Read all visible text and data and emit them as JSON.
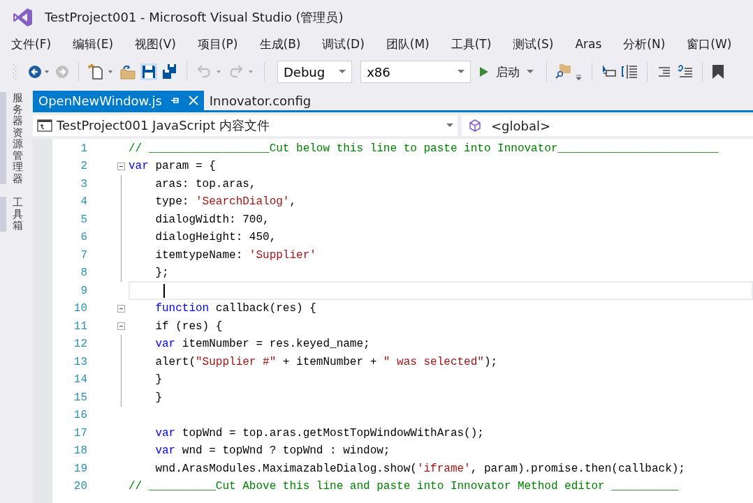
{
  "window": {
    "title": "TestProject001 - Microsoft Visual Studio (管理员)"
  },
  "menu": [
    "文件(F)",
    "编辑(E)",
    "视图(V)",
    "项目(P)",
    "生成(B)",
    "调试(D)",
    "团队(M)",
    "工具(T)",
    "测试(S)",
    "Aras",
    "分析(N)",
    "窗口(W)"
  ],
  "toolbar": [
    {
      "kind": "back",
      "disabled": false
    },
    {
      "kind": "forward",
      "disabled": true
    },
    {
      "kind": "sep"
    },
    {
      "kind": "new-item"
    },
    {
      "kind": "open"
    },
    {
      "kind": "save"
    },
    {
      "kind": "save-all"
    },
    {
      "kind": "sep"
    },
    {
      "kind": "undo",
      "disabled": true
    },
    {
      "kind": "redo",
      "disabled": true
    },
    {
      "kind": "sep"
    },
    {
      "kind": "combo",
      "value": "Debug"
    },
    {
      "kind": "combo",
      "value": "x86"
    },
    {
      "kind": "start",
      "label": "启动"
    },
    {
      "kind": "sep"
    },
    {
      "kind": "find"
    },
    {
      "kind": "sep"
    },
    {
      "kind": "select"
    },
    {
      "kind": "outline"
    },
    {
      "kind": "sep"
    },
    {
      "kind": "indent"
    },
    {
      "kind": "unindent"
    },
    {
      "kind": "sep"
    },
    {
      "kind": "bookmark"
    }
  ],
  "side_tabs": [
    "服务器资源管理器",
    "工具箱"
  ],
  "tabs": [
    {
      "label": "OpenNewWindow.js",
      "selected": true
    },
    {
      "label": "Innovator.config",
      "selected": false
    }
  ],
  "nav_bar": {
    "project": "TestProject001 JavaScript 内容文件",
    "scope": "<global>"
  },
  "lines": [
    {
      "number": "1",
      "indented": false,
      "collapsible": false,
      "in_block": false,
      "current": false,
      "code": [
        {
          "kind": "comment",
          "text": "// __________________Cut below this line to paste into Innovator________________________"
        }
      ]
    },
    {
      "number": "2",
      "indented": false,
      "collapsible": true,
      "current": false,
      "code": [
        {
          "kind": "keyword",
          "text": "var"
        },
        {
          "kind": "plain",
          "text": " param = {"
        }
      ]
    },
    {
      "number": "3",
      "indented": true,
      "collapsible": false,
      "in_block": true,
      "current": false,
      "code": [
        {
          "kind": "plain",
          "text": "aras: top.aras,"
        }
      ]
    },
    {
      "number": "4",
      "indented": true,
      "collapsible": false,
      "in_block": true,
      "current": false,
      "code": [
        {
          "kind": "plain",
          "text": "type: "
        },
        {
          "kind": "string",
          "text": "'SearchDialog'"
        },
        {
          "kind": "plain",
          "text": ","
        }
      ]
    },
    {
      "number": "5",
      "indented": true,
      "collapsible": false,
      "in_block": true,
      "current": false,
      "code": [
        {
          "kind": "plain",
          "text": "dialogWidth: 700,"
        }
      ]
    },
    {
      "number": "6",
      "indented": true,
      "collapsible": false,
      "in_block": true,
      "current": false,
      "code": [
        {
          "kind": "plain",
          "text": "dialogHeight: 450,"
        }
      ]
    },
    {
      "number": "7",
      "indented": true,
      "collapsible": false,
      "in_block": true,
      "current": false,
      "code": [
        {
          "kind": "plain",
          "text": "itemtypeName: "
        },
        {
          "kind": "string",
          "text": "'Supplier'"
        }
      ]
    },
    {
      "number": "8",
      "indented": true,
      "collapsible": false,
      "in_block": true,
      "current": false,
      "code": [
        {
          "kind": "plain",
          "text": "};"
        }
      ]
    },
    {
      "number": "9",
      "collapsible": false,
      "in_block": false,
      "current": true
    },
    {
      "number": "10",
      "indented": true,
      "collapsible": true,
      "current": false,
      "code": [
        {
          "kind": "keyword",
          "text": "function"
        },
        {
          "kind": "plain",
          "text": " callback(res) {"
        }
      ]
    },
    {
      "number": "11",
      "indented": true,
      "collapsible": true,
      "current": false,
      "code": [
        {
          "kind": "plain",
          "text": "if (res) {"
        }
      ]
    },
    {
      "number": "12",
      "indented": true,
      "collapsible": false,
      "in_block": true,
      "current": false,
      "code": [
        {
          "kind": "keyword",
          "text": "var"
        },
        {
          "kind": "plain",
          "text": " itemNumber = res.keyed_name;"
        }
      ]
    },
    {
      "number": "13",
      "indented": true,
      "collapsible": false,
      "in_block": true,
      "current": false,
      "code": [
        {
          "kind": "plain",
          "text": "alert("
        },
        {
          "kind": "string",
          "text": "\"Supplier #\""
        },
        {
          "kind": "plain",
          "text": " + itemNumber + "
        },
        {
          "kind": "string",
          "text": "\" was selected\""
        },
        {
          "kind": "plain",
          "text": ");"
        }
      ]
    },
    {
      "number": "14",
      "indented": true,
      "collapsible": false,
      "in_block": true,
      "current": false,
      "code": [
        {
          "kind": "plain",
          "text": "}"
        }
      ]
    },
    {
      "number": "15",
      "indented": true,
      "collapsible": false,
      "in_block": true,
      "current": false,
      "code": [
        {
          "kind": "plain",
          "text": "}"
        }
      ]
    },
    {
      "number": "16",
      "collapsible": false,
      "in_block": false,
      "current": false
    },
    {
      "number": "17",
      "indented": true,
      "collapsible": false,
      "in_block": false,
      "current": false,
      "code": [
        {
          "kind": "keyword",
          "text": "var"
        },
        {
          "kind": "plain",
          "text": " topWnd = top.aras.getMostTopWindowWithAras();"
        }
      ]
    },
    {
      "number": "18",
      "indented": true,
      "collapsible": false,
      "in_block": false,
      "current": false,
      "code": [
        {
          "kind": "keyword",
          "text": "var"
        },
        {
          "kind": "plain",
          "text": " wnd = topWnd ? topWnd : window;"
        }
      ]
    },
    {
      "number": "19",
      "indented": true,
      "collapsible": false,
      "in_block": false,
      "current": false,
      "code": [
        {
          "kind": "plain",
          "text": "wnd.ArasModules.MaximazableDialog.show("
        },
        {
          "kind": "string",
          "text": "'iframe'"
        },
        {
          "kind": "plain",
          "text": ", param).promise.then(callback);"
        }
      ]
    },
    {
      "number": "20",
      "indented": false,
      "collapsible": false,
      "in_block": false,
      "current": false,
      "code": [
        {
          "kind": "comment",
          "text": "// __________Cut Above this line and paste into Innovator Method editor __________"
        }
      ]
    }
  ]
}
